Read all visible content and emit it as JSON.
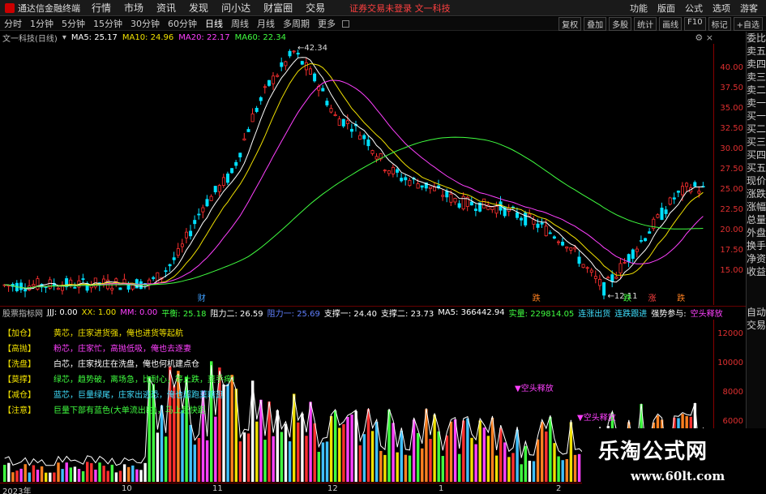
{
  "menubar": {
    "app_name": "通达信金融终端",
    "items": [
      "行情",
      "市场",
      "资讯",
      "发现",
      "问小达",
      "财富圈",
      "交易"
    ],
    "notice": "证券交易未登录  文一科技",
    "right_items": [
      "功能",
      "版面",
      "公式",
      "选项",
      "游客"
    ]
  },
  "periods": [
    "分时",
    "1分钟",
    "5分钟",
    "15分钟",
    "30分钟",
    "60分钟",
    "日线",
    "周线",
    "月线",
    "多周期",
    "更多"
  ],
  "active_period": "日线",
  "tools": [
    "复权",
    "叠加",
    "多股",
    "统计",
    "画线",
    "F10",
    "标记",
    "+自选"
  ],
  "mainbar": {
    "title": "文一科技(日线)",
    "ma5": "MA5: 25.17",
    "ma10": "MA10: 24.96",
    "ma20": "MA20: 22.17",
    "ma60": "MA60: 22.34"
  },
  "price_ticks": [
    "40.00",
    "37.50",
    "35.00",
    "32.50",
    "30.00",
    "27.50",
    "25.00",
    "22.50",
    "20.00",
    "17.50",
    "15.00"
  ],
  "chart_annotations": {
    "high": "42.34",
    "low": "12.11",
    "markers": [
      "财",
      "跌",
      "跌",
      "涨",
      "跌"
    ]
  },
  "side_tabs": [
    "委比",
    "卖五",
    "卖四",
    "卖三",
    "卖二",
    "卖一",
    "买一",
    "买二",
    "买三",
    "买四",
    "买五",
    "现价",
    "涨跌",
    "涨幅",
    "总量",
    "外盘",
    "换手",
    "净资",
    "收益",
    "自动",
    "交易"
  ],
  "subbar": {
    "name": "股票指标网",
    "jjj": "JJJ: 0.00",
    "xx": "XX: 1.00",
    "mm": "MM: 0.00",
    "pingheng": "平衡: 25.18",
    "zuli2": "阻力二: 26.59",
    "zuli1": "阻力一: 25.69",
    "zhicheng1": "支撑一: 24.40",
    "zhicheng2": "支撑二: 23.73",
    "ma5v": "MA5: 366442.94",
    "shiliang": "实量: 229814.05",
    "state1": "连涨出货",
    "state2": "连跌跟进",
    "strength": "强势参与:",
    "strength_val": "空头释放"
  },
  "legend": [
    {
      "tag": "【加仓】",
      "desc": "黄芯，庄家进货强，俺也进货等起航"
    },
    {
      "tag": "【高抛】",
      "desc": "粉芯，庄家忙，高抛低吸，俺也去逐妻"
    },
    {
      "tag": "【洗盘】",
      "desc": "白芯，庄家找庄在洗盘，俺也何机建点仓"
    },
    {
      "tag": "【莫撑】",
      "desc": "绿芯，趋势破，离场急，比耐心，等止跌，莫手痒!"
    },
    {
      "tag": "【减仓】",
      "desc": "蓝芯，巨量绿尾，庄家出逃恐，俺也超跑莫瞎逛"
    },
    {
      "tag": "【注意】",
      "desc": "巨量下部有蓝色(大单流出时)，马上赶快跑"
    }
  ],
  "sub_ticks": [
    "12000",
    "10000",
    "8000",
    "6000"
  ],
  "sub_annotations": [
    "▼空头释放",
    "▼空头释放"
  ],
  "xaxis_labels": [
    "2023年",
    "10",
    "11",
    "12",
    "1",
    "2"
  ],
  "watermark": {
    "title": "乐淘公式网",
    "url": "www.60lt.com"
  },
  "colors": {
    "up": "#ff3030",
    "down": "#00e0ff",
    "ma5": "#ffffff",
    "ma10": "#f0e000",
    "ma20": "#ff40ff",
    "ma60": "#40ff40"
  }
}
